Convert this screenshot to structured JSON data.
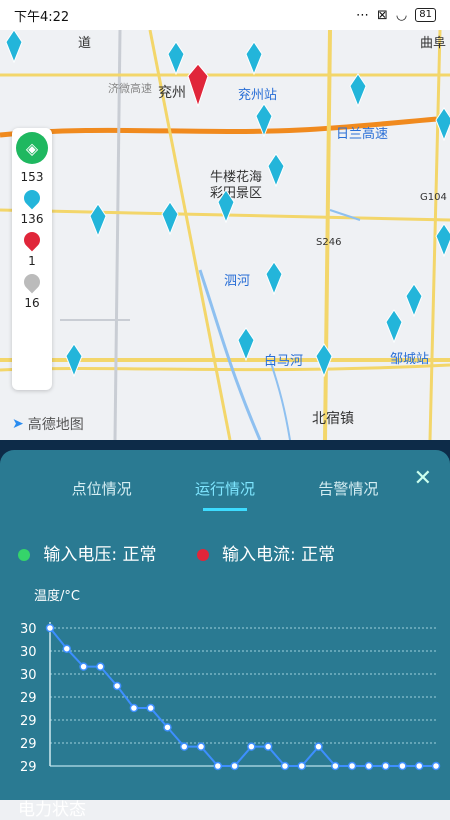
{
  "statusbar": {
    "time": "下午4:22",
    "battery": "81"
  },
  "map": {
    "labels": {
      "qufu": "曲阜",
      "yanzhou": "兖州",
      "yanzhou_station": "兖州站",
      "ri_lan": "日兰高速",
      "niulou": "牛楼花海",
      "caitian": "彩田景区",
      "g104": "G104",
      "s246": "S246",
      "sihe": "泗河",
      "baimahe": "白马河",
      "zoucheng_station": "邹城站",
      "beisuzhen": "北宿镇",
      "dao": "道",
      "jiwei": "济微高速"
    },
    "layer_panel": {
      "count_green": "153",
      "count_red": "136",
      "count_gray": "1",
      "count_total": "16"
    },
    "logo": "高德地图"
  },
  "sheet": {
    "tabs": [
      "点位情况",
      "运行情况",
      "告警情况"
    ],
    "active_tab": "运行情况",
    "voltage_label": "输入电压:",
    "voltage_value": "正常",
    "current_label": "输入电流:",
    "current_value": "正常",
    "cut_text": "电力状态"
  },
  "chart_data": {
    "type": "line",
    "ylabel": "温度/°C",
    "ytick_labels": [
      "30",
      "30",
      "30",
      "29",
      "29",
      "29",
      "29"
    ],
    "ylim": [
      29.0,
      30.0
    ],
    "values": [
      30.0,
      29.85,
      29.72,
      29.72,
      29.58,
      29.42,
      29.42,
      29.28,
      29.14,
      29.14,
      29.0,
      29.0,
      29.14,
      29.14,
      29.0,
      29.0,
      29.14,
      29.0,
      29.0,
      29.0,
      29.0,
      29.0,
      29.0,
      29.0
    ],
    "line_color": "#3d8fff",
    "grid": true
  }
}
